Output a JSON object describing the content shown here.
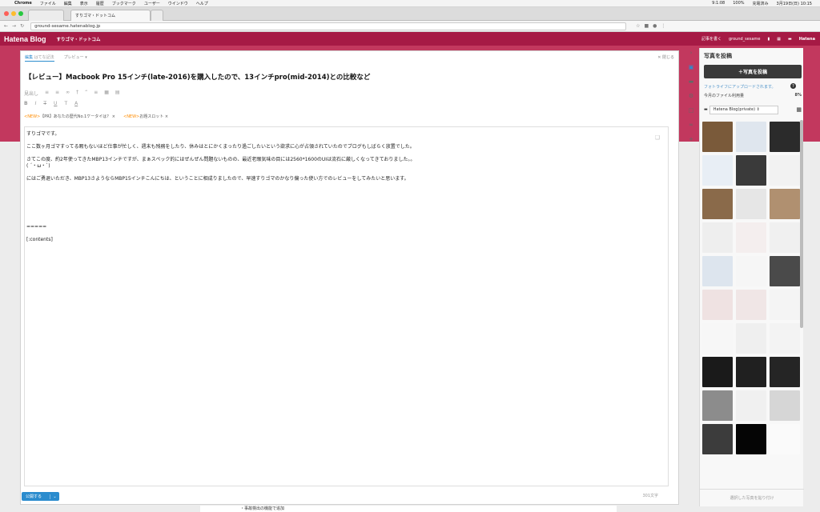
{
  "menubar": {
    "app": "Chrome",
    "items": [
      "ファイル",
      "編集",
      "表示",
      "履歴",
      "ブックマーク",
      "ユーザー",
      "ウインドウ",
      "ヘルプ"
    ],
    "battery": "100%",
    "battery_label": "充電済み",
    "date_time": "3月19日(日) 10:15",
    "time_small": "9:1:08"
  },
  "tabs": [
    {
      "label": "すりゴマ・ドットコム"
    },
    {
      "label": ""
    }
  ],
  "address": {
    "url": "ground-sesame.hatenablog.jp"
  },
  "hatena": {
    "logo": "Hatena Blog",
    "blog_name": "すりゴマ・ドットコム",
    "write": "記事を書く",
    "user": "ground_sesame",
    "brand": "Hatena"
  },
  "editor": {
    "mode_edit": "編集",
    "mode_sub": "はてな記法",
    "mode_preview": "プレビュー",
    "close": "閉じる",
    "title": "【レビュー】Macbook Pro 15インチ(late-2016)を購入したので、13インチpro(mid-2014)との比較など",
    "format_select": "見出し",
    "notices": [
      {
        "badge": "<NEW>",
        "text": "【PR】あなたの歴代No.1ケータイは？"
      },
      {
        "badge": "<NEW>",
        "text": "お題スロット"
      }
    ],
    "paragraphs": [
      "すりゴマです。",
      "ここ数ヶ月ゴマすってる暇もないほど仕事が忙しく、週末も残務をしたり、休みはとにかくまったり過ごしたいという欲求に心が占領されていたのでブログもしばらく放置でした。",
      "さてこの度、約2年使ってきたMBP13インチですが、まぁスペック的にはぜんぜん問題ないものの、最近老眼気味の目には2560*1600のUIは流石に厳しくなってきておりました。。",
      "( ´・ω・`)",
      "にはご勇退いただき、MBP13さようならMBP15インチこんにちは、ということに相成りましたので、早速すりゴマのかなり偏った使い方でのレビューをしてみたいと思います。",
      "=====",
      "[:contents]"
    ],
    "publish": "公開する",
    "char_count": "301文字"
  },
  "panel": {
    "title": "写真を投稿",
    "post_button": "＋写真を投稿",
    "fotolife_link": "フォトライフにアップロードされます。",
    "usage_label": "今月のファイル利用量",
    "usage_value": "8%",
    "folder": "Hatena Blog(private)",
    "footer": "選択した写真を貼り付け",
    "thumb_colors": [
      "#7a5a3a",
      "#dfe6ee",
      "#2b2b2b",
      "#e8eef5",
      "#3a3a3a",
      "#f2f2f2",
      "#8a6a4a",
      "#e6e6e6",
      "#b09070",
      "#eeeeee",
      "#f4eeee",
      "#f0f0f0",
      "#dde5ee",
      "#f6f6f6",
      "#4a4a4a",
      "#efe2e2",
      "#f0e6e6",
      "#f4f4f4",
      "#f7f7f7",
      "#efefef",
      "#f3f3f3",
      "#1a1a1a",
      "#202020",
      "#252525",
      "#8c8c8c",
      "#f0f0f0",
      "#d6d6d6",
      "#3c3c3c",
      "#050505",
      "#fafafa"
    ]
  },
  "below_text": "・事故検出の機能で追加"
}
